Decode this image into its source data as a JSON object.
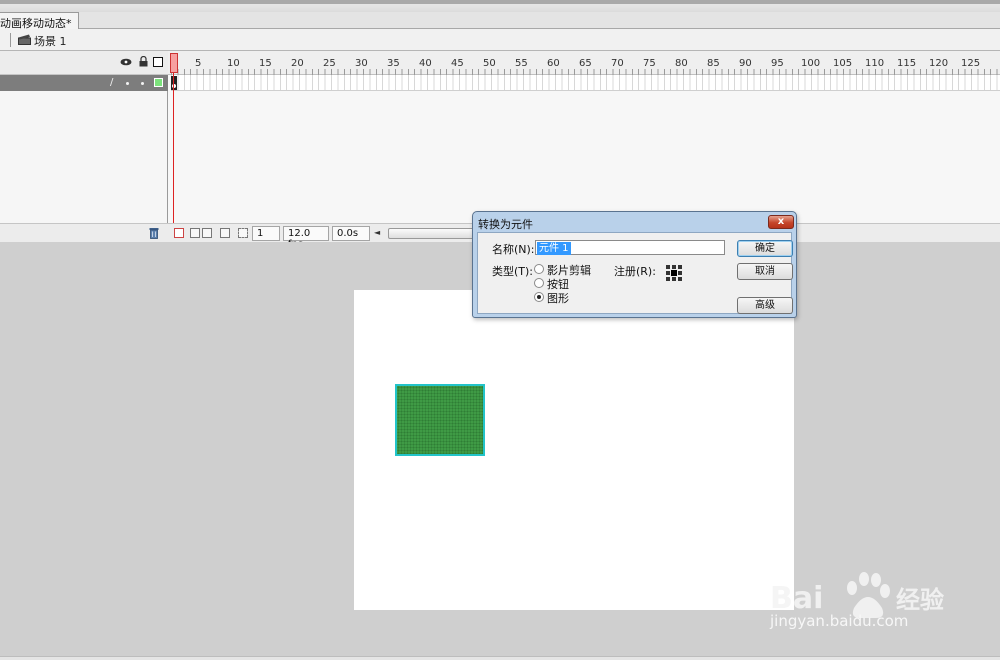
{
  "document": {
    "tab_title": "动画移动动态*"
  },
  "edit_bar": {
    "scene_label": "场景 1"
  },
  "timeline": {
    "ruler_numbers": [
      "5",
      "10",
      "15",
      "20",
      "25",
      "30",
      "35",
      "40",
      "45",
      "50",
      "55",
      "60",
      "65",
      "70",
      "75",
      "80",
      "85",
      "90",
      "95",
      "100",
      "105",
      "110",
      "115",
      "120",
      "125"
    ],
    "current_frame": "1",
    "fps": "12.0 fps",
    "elapsed": "0.0s",
    "layer_outline_color": "#7ce27c",
    "header_icons": [
      "eye-icon",
      "lock-icon",
      "outline-icon"
    ]
  },
  "stage": {
    "shape_fill": "#3f9a45",
    "selection_color": "#23c4c9"
  },
  "dialog": {
    "title": "转换为元件",
    "close_glyph": "x",
    "name_label": "名称(N):",
    "name_value": "元件 1",
    "type_label": "类型(T):",
    "types": [
      "影片剪辑",
      "按钮",
      "图形"
    ],
    "selected_type": "图形",
    "registration_label": "注册(R):",
    "ok_label": "确定",
    "cancel_label": "取消",
    "advanced_label": "高级"
  },
  "watermark": {
    "brand": "Bai du 经验",
    "url": "jingyan.baidu.com"
  }
}
